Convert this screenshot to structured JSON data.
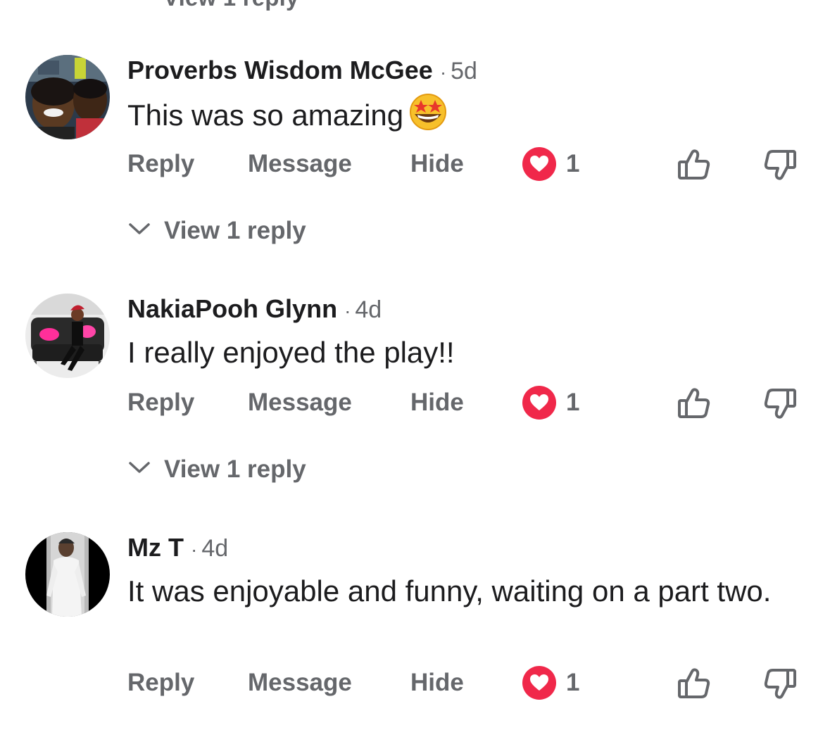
{
  "top_partial": {
    "label": "View 1 reply"
  },
  "colors": {
    "text_primary": "#1c1c1e",
    "text_secondary": "#65676b",
    "heart_reaction": "#f0284a",
    "background": "#ffffff"
  },
  "comments": [
    {
      "author": "Proverbs Wisdom McGee",
      "separator": "·",
      "time": "5d",
      "text": "This was so amazing",
      "emoji": "star-struck-emoji",
      "actions": {
        "reply": "Reply",
        "message": "Message",
        "hide": "Hide"
      },
      "reaction": {
        "icon": "heart-reaction-icon",
        "count": "1"
      },
      "view_replies": "View 1 reply",
      "avatar": "avatar-photo-two-people"
    },
    {
      "author": "NakiaPooh Glynn",
      "separator": "·",
      "time": "4d",
      "text": "I really enjoyed the play!!",
      "actions": {
        "reply": "Reply",
        "message": "Message",
        "hide": "Hide"
      },
      "reaction": {
        "icon": "heart-reaction-icon",
        "count": "1"
      },
      "view_replies": "View 1 reply",
      "avatar": "avatar-photo-person-on-couch"
    },
    {
      "author": "Mz T",
      "separator": "·",
      "time": "4d",
      "text": "It was enjoyable and funny, waiting on a part two.",
      "actions": {
        "reply": "Reply",
        "message": "Message",
        "hide": "Hide"
      },
      "reaction": {
        "icon": "heart-reaction-icon",
        "count": "1"
      },
      "avatar": "avatar-photo-person-white-outfit"
    }
  ]
}
